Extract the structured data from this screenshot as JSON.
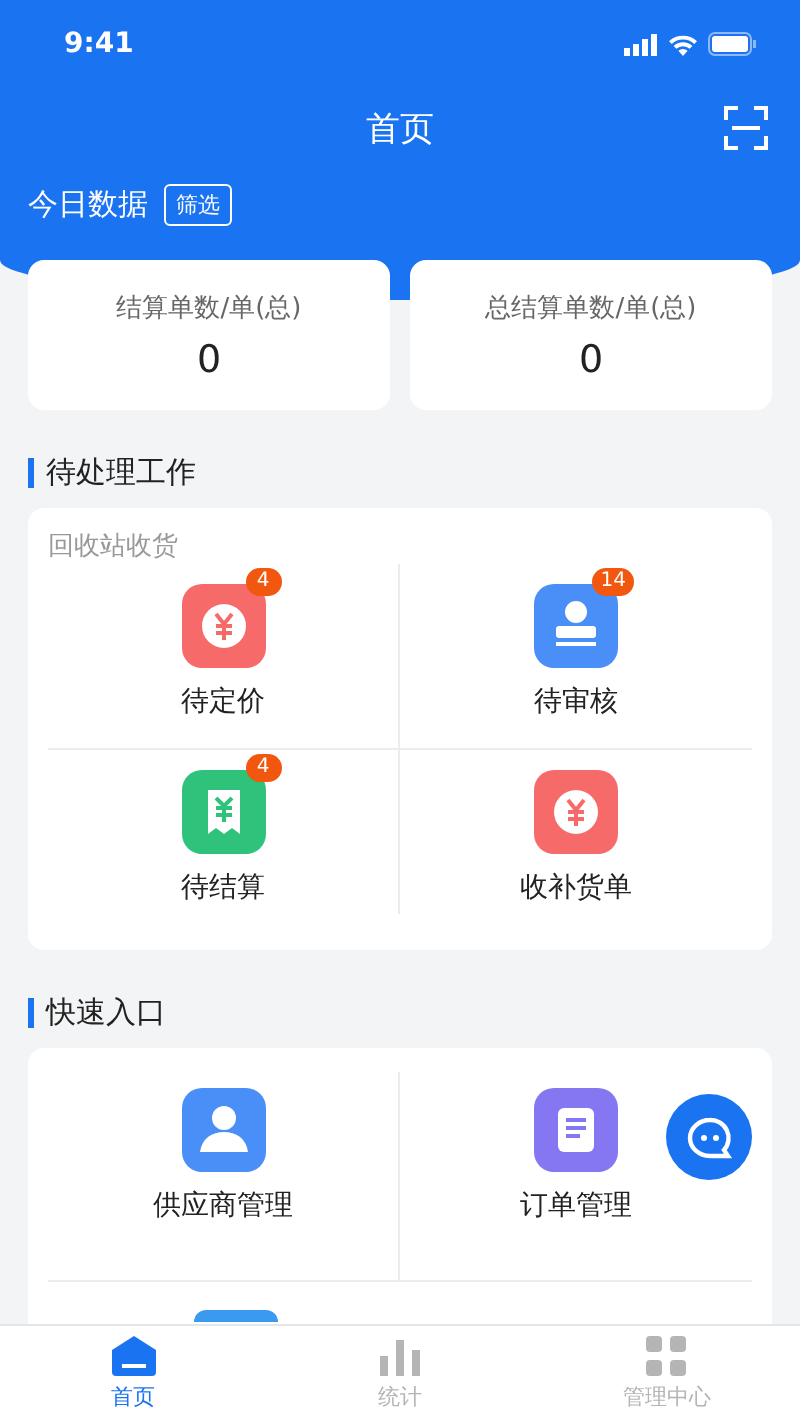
{
  "status_bar": {
    "time": "9:41"
  },
  "header": {
    "title": "首页"
  },
  "today": {
    "label": "今日数据",
    "filter_button": "筛选"
  },
  "stats": [
    {
      "label": "结算单数/单(总)",
      "value": "0"
    },
    {
      "label": "总结算单数/单(总)",
      "value": "0"
    }
  ],
  "pending": {
    "title": "待处理工作",
    "subtitle": "回收站收货",
    "items": [
      {
        "label": "待定价",
        "kind": "yen",
        "color": "#f76a6a",
        "badge": "4"
      },
      {
        "label": "待审核",
        "kind": "stamp",
        "color": "#4a8ef7",
        "badge": "14"
      },
      {
        "label": "待结算",
        "kind": "receipt",
        "color": "#2fc27a",
        "badge": "4"
      },
      {
        "label": "收补货单",
        "kind": "yen",
        "color": "#f76a6a"
      }
    ]
  },
  "quick": {
    "title": "快速入口",
    "items": [
      {
        "label": "供应商管理",
        "kind": "person",
        "color": "#4a8ef7"
      },
      {
        "label": "订单管理",
        "kind": "doc",
        "color": "#8577f2"
      }
    ]
  },
  "tabs": [
    {
      "label": "首页",
      "kind": "home",
      "selected": true
    },
    {
      "label": "统计",
      "kind": "bars",
      "selected": false
    },
    {
      "label": "管理中心",
      "kind": "grid",
      "selected": false
    }
  ]
}
